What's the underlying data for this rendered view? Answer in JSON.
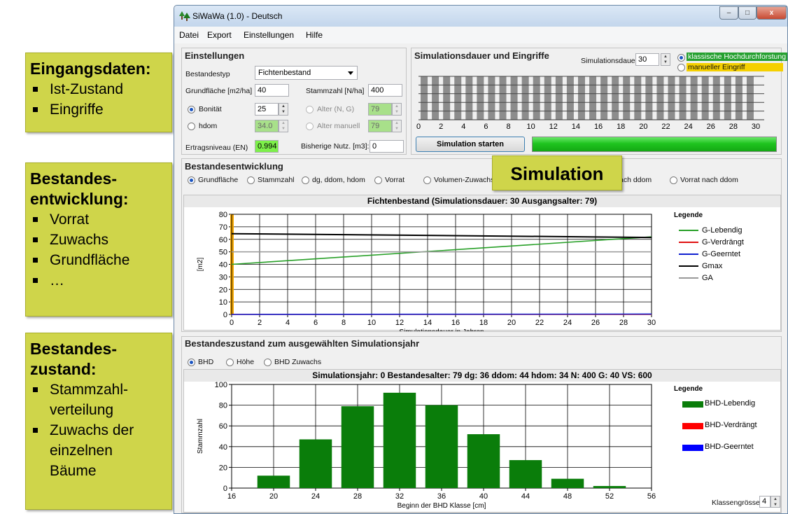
{
  "window": {
    "title": "SiWaWa (1.0) - Deutsch",
    "controls": {
      "minimize": "–",
      "maximize": "□",
      "close": "x"
    }
  },
  "menu": [
    "Datei",
    "Export",
    "Einstellungen",
    "Hilfe"
  ],
  "callouts": {
    "input": {
      "title": "Eingangsdaten:",
      "items": [
        "Ist-Zustand",
        "Eingriffe"
      ]
    },
    "development": {
      "title": "Bestandes-\nentwicklung:",
      "items": [
        "Vorrat",
        "Zuwachs",
        "Grundfläche",
        "…"
      ]
    },
    "state": {
      "title": "Bestandes-\nzustand:",
      "items": [
        {
          "text": "Stammzahl-",
          "bullet": true
        },
        {
          "text": "verteilung",
          "bullet": false
        },
        {
          "text": "Zuwachs der",
          "bullet": true
        },
        {
          "text": "einzelnen",
          "bullet": false
        },
        {
          "text": "Bäume",
          "bullet": false
        }
      ]
    },
    "simulation": "Simulation"
  },
  "settings": {
    "title": "Einstellungen",
    "bestandestyp_label": "Bestandestyp",
    "bestandestyp_value": "Fichtenbestand",
    "grundflaeche_label": "Grundfläche [m2/ha]",
    "grundflaeche_value": "40",
    "stammzahl_label": "Stammzahl [N/ha]",
    "stammzahl_value": "400",
    "bonitaet_label": "Bonität",
    "bonitaet_value": "25",
    "hdom_label": "hdom",
    "hdom_value": "34.0",
    "alter_ng_label": "Alter (N, G)",
    "alter_ng_value": "79",
    "alter_manuell_label": "Alter manuell",
    "alter_manuell_value": "79",
    "ertragsniveau_label": "Ertragsniveau (EN)",
    "ertragsniveau_value": "0.994",
    "bisherige_label": "Bisherige Nutz. [m3]:",
    "bisherige_value": "0"
  },
  "simulation": {
    "title": "Simulationsdauer und Eingriffe",
    "dauer_label": "Simulationsdauer",
    "dauer_value": "30",
    "option_klassisch": "klassische Hochdurchforstung",
    "option_manuell": "manueller Eingriff",
    "start_button": "Simulation starten",
    "progress": 1.0,
    "axis_ticks": [
      "0",
      "2",
      "4",
      "6",
      "8",
      "10",
      "12",
      "14",
      "16",
      "18",
      "20",
      "22",
      "24",
      "26",
      "28",
      "30"
    ]
  },
  "development": {
    "title": "Bestandesentwicklung",
    "options": [
      "Grundfläche",
      "Stammzahl",
      "dg, ddom, hdom",
      "Vorrat",
      "Volumen-Zuwachs",
      "ach ddom",
      "Vorrat nach ddom"
    ],
    "selected": "Grundfläche"
  },
  "chart1_header": "Fichtenbestand  (Simulationsdauer: 30    Ausgangsalter: 79)",
  "state": {
    "title": "Bestandeszustand zum ausgewählten Simulationsjahr",
    "options": [
      "BHD",
      "Höhe",
      "BHD Zuwachs"
    ],
    "selected": "BHD",
    "header": "Simulationsjahr: 0   Bestandesalter: 79   dg: 36   ddom: 44   hdom: 34   N: 400   G: 40   VS: 600",
    "klassen_label": "Klassengrösse:",
    "klassen_value": "4"
  },
  "colors": {
    "callout": "#cfd54a",
    "progress": "#1fc41f",
    "bar": "#0a7d0a",
    "selected_green": "#25a030",
    "yellow": "#f5d000"
  },
  "chart_data": [
    {
      "type": "line",
      "title": "Fichtenbestand  (Simulationsdauer: 30    Ausgangsalter: 79)",
      "xlabel": "Simulationsdauer in Jahren",
      "ylabel": "[m2]",
      "xlim": [
        0,
        30
      ],
      "ylim": [
        0,
        80
      ],
      "xticks": [
        "0",
        "2",
        "4",
        "6",
        "8",
        "10",
        "12",
        "14",
        "16",
        "18",
        "20",
        "22",
        "24",
        "26",
        "28",
        "30"
      ],
      "yticks": [
        "0",
        "10",
        "20",
        "30",
        "40",
        "50",
        "60",
        "70",
        "80"
      ],
      "legend_title": "Legende",
      "legend_position": "right",
      "grid": true,
      "series": [
        {
          "name": "G-Lebendig",
          "color": "#28a028",
          "x": [
            0,
            30
          ],
          "y": [
            40,
            62
          ]
        },
        {
          "name": "G-Verdrängt",
          "color": "#e01010",
          "x": [
            0,
            30
          ],
          "y": [
            0,
            0
          ]
        },
        {
          "name": "G-Geerntet",
          "color": "#1020d0",
          "x": [
            0,
            30
          ],
          "y": [
            0,
            0.3
          ]
        },
        {
          "name": "Gmax",
          "color": "#000000",
          "x": [
            0,
            30
          ],
          "y": [
            64.5,
            61.5
          ]
        },
        {
          "name": "GA",
          "color": "#999999",
          "x": [
            0,
            30
          ],
          "y": [
            50,
            50
          ]
        }
      ]
    },
    {
      "type": "bar",
      "xlabel": "Beginn der BHD Klasse [cm]",
      "ylabel": "Stammzahl",
      "xlim": [
        16,
        56
      ],
      "ylim": [
        0,
        100
      ],
      "xticks": [
        "16",
        "20",
        "24",
        "28",
        "32",
        "36",
        "40",
        "44",
        "48",
        "52",
        "56"
      ],
      "yticks": [
        "0",
        "20",
        "40",
        "60",
        "80",
        "100"
      ],
      "legend_title": "Legende",
      "legend_position": "right",
      "grid": true,
      "categories": [
        "20",
        "24",
        "28",
        "32",
        "36",
        "40",
        "44",
        "48",
        "52"
      ],
      "series": [
        {
          "name": "BHD-Lebendig",
          "color": "#0a7d0a",
          "values": [
            12,
            47,
            79,
            92,
            80,
            52,
            27,
            9,
            2
          ]
        },
        {
          "name": "BHD-Verdrängt",
          "color": "#ff0000",
          "values": [
            0,
            0,
            0,
            0,
            0,
            0,
            0,
            0,
            0
          ]
        },
        {
          "name": "BHD-Geerntet",
          "color": "#0000ff",
          "values": [
            0,
            0,
            0,
            0,
            0,
            0,
            0,
            0,
            0
          ]
        }
      ]
    }
  ]
}
